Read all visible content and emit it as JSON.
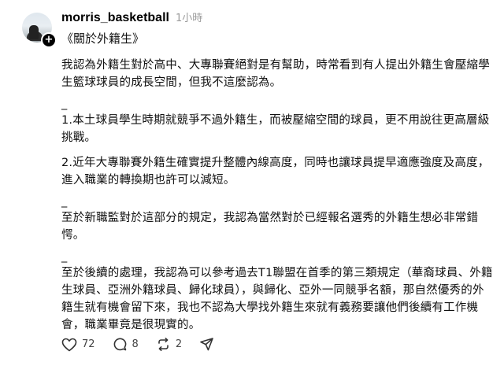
{
  "post": {
    "username": "morris_basketball",
    "timestamp": "1小時",
    "topic": "《關於外籍生》",
    "paragraphs": {
      "p1": "我認為外籍生對於高中、大專聯賽絕對是有幫助，時常看到有人提出外籍生會壓縮學生籃球球員的成長空間，但我不這麼認為。",
      "sep1": "_",
      "p2": "1.本土球員學生時期就競爭不過外籍生，而被壓縮空間的球員，更不用說往更高層級挑戰。",
      "p3": "2.近年大專聯賽外籍生確實提升整體內線高度，同時也讓球員提早適應強度及高度，進入職業的轉換期也許可以減短。",
      "sep2": "_",
      "p4": "至於新職監對於這部分的規定，我認為當然對於已經報名選秀的外籍生想必非常錯愕。",
      "sep3": "_",
      "p5": "至於後續的處理，我認為可以參考過去T1聯盟在首季的第三類規定（華裔球員、外籍生球員、亞洲外籍球員、歸化球員），與歸化、亞外一同競爭名額，那自然優秀的外籍生就有機會留下來，我也不認為大學找外籍生來就有義務要讓他們後續有工作機會，職業畢竟是很現實的。"
    }
  },
  "actions": {
    "likes": "72",
    "comments": "8",
    "reposts": "2"
  },
  "icons": {
    "avatar_plus": "+",
    "like": "heart-icon",
    "comment": "comment-icon",
    "repost": "repost-icon",
    "share": "share-icon"
  }
}
